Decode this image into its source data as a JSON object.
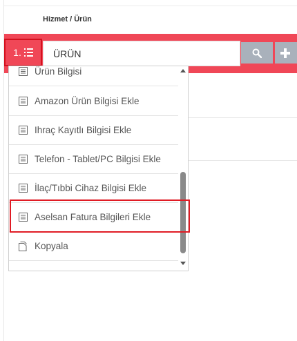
{
  "header": {
    "title": "Hizmet / Ürün"
  },
  "row": {
    "number_label": "1.",
    "number_icon": "list-numbered-icon"
  },
  "product_input": {
    "value": "ÜRÜN"
  },
  "buttons": {
    "search_icon": "search-icon",
    "add_icon": "plus-icon"
  },
  "dropdown": {
    "items": [
      {
        "label": "Ürün Bilgisi",
        "icon": "document-lines-icon"
      },
      {
        "label": "Amazon Ürün Bilgisi Ekle",
        "icon": "document-lines-icon"
      },
      {
        "label": "Ihraç Kayıtlı Bilgisi Ekle",
        "icon": "document-lines-icon"
      },
      {
        "label": "Telefon - Tablet/PC Bilgisi Ekle",
        "icon": "document-lines-icon"
      },
      {
        "label": "İlaç/Tıbbi Cihaz Bilgisi Ekle",
        "icon": "document-lines-icon"
      },
      {
        "label": "Aselsan Fatura Bilgileri Ekle",
        "icon": "document-lines-icon"
      },
      {
        "label": "Kopyala",
        "icon": "copy-icon"
      }
    ],
    "highlighted_item": "Aselsan Fatura Bilgileri Ekle"
  },
  "colors": {
    "accent_red": "#f04757",
    "highlight_border": "#e01b24",
    "button_gray": "#a9b1bb"
  }
}
